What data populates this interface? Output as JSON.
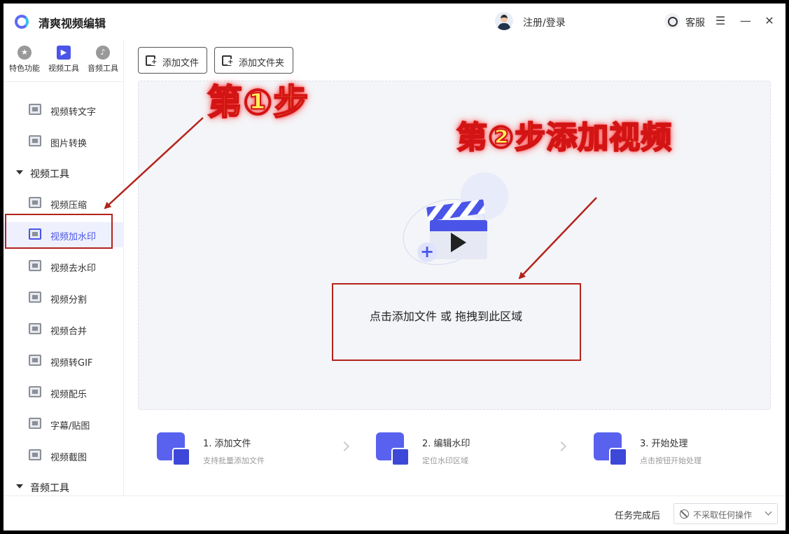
{
  "app": {
    "title": "清爽视频编辑"
  },
  "header": {
    "login_label": "注册/登录",
    "service_label": "客服",
    "menu_glyph": "☰",
    "minimize_glyph": "—",
    "close_glyph": "✕"
  },
  "sidebar": {
    "tabs": [
      {
        "label": "特色功能",
        "icon": "star-icon",
        "glyph": "★"
      },
      {
        "label": "视频工具",
        "icon": "video-icon",
        "glyph": "▶"
      },
      {
        "label": "音频工具",
        "icon": "music-icon",
        "glyph": "♪"
      }
    ],
    "items_top": [
      {
        "label": "视频转文字",
        "icon": "video-text-icon"
      },
      {
        "label": "图片转换",
        "icon": "image-icon"
      }
    ],
    "group_video": "视频工具",
    "items_video": [
      {
        "label": "视频压缩",
        "icon": "compress-icon"
      },
      {
        "label": "视频加水印",
        "icon": "watermark-icon"
      },
      {
        "label": "视频去水印",
        "icon": "remove-watermark-icon"
      },
      {
        "label": "视频分割",
        "icon": "split-icon"
      },
      {
        "label": "视频合并",
        "icon": "merge-icon"
      },
      {
        "label": "视频转GIF",
        "icon": "gif-icon"
      },
      {
        "label": "视频配乐",
        "icon": "music-icon"
      },
      {
        "label": "字幕/贴图",
        "icon": "subtitle-icon"
      },
      {
        "label": "视频截图",
        "icon": "screenshot-icon"
      }
    ],
    "group_audio": "音频工具",
    "active_item": "视频加水印"
  },
  "toolbar": {
    "add_file": "添加文件",
    "add_folder": "添加文件夹"
  },
  "dropzone": {
    "text": "点击添加文件 或 拖拽到此区域",
    "illustration": "clapperboard-icon"
  },
  "steps": [
    {
      "title": "1. 添加文件",
      "desc": "支持批量添加文件",
      "icon": "add-file-icon"
    },
    {
      "title": "2. 编辑水印",
      "desc": "定位水印区域",
      "icon": "edit-watermark-icon"
    },
    {
      "title": "3. 开始处理",
      "desc": "点击按钮开始处理",
      "icon": "process-icon"
    }
  ],
  "statusbar": {
    "after_label": "任务完成后",
    "after_value": "不采取任何操作"
  },
  "annotations": {
    "step1": "第①步",
    "step2": "第②步添加视频"
  },
  "colors": {
    "accent": "#4a55e8",
    "annotation_red": "#b3231b",
    "annotation_yellow": "#fff05a"
  }
}
